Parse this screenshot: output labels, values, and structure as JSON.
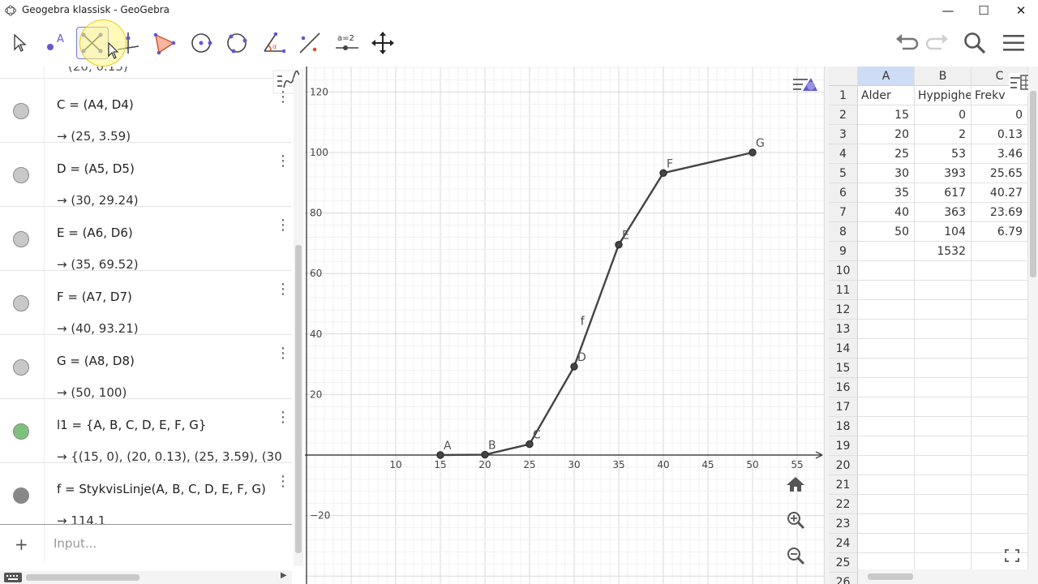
{
  "window": {
    "title": "Geogebra klassisk - GeoGebra",
    "minimize": "—",
    "maximize": "☐",
    "close": "✕"
  },
  "toolbar": {
    "tools": [
      "move-tool",
      "point-tool",
      "polygon-tool",
      "line-tool",
      "perpendicular-tool",
      "circle-tool",
      "conic-tool",
      "angle-tool",
      "reflect-tool",
      "slider-tool",
      "move-graphics-tool"
    ],
    "slider_label": "a=2",
    "right_icons": [
      "undo-icon",
      "redo-icon",
      "search-icon",
      "menu-icon"
    ]
  },
  "algebra": {
    "rows": [
      {
        "def": "C = (A4, D4)",
        "val": "→  (25, 3.59)",
        "color": "#c8c8c8"
      },
      {
        "def": "D = (A5, D5)",
        "val": "→  (30, 29.24)",
        "color": "#c8c8c8"
      },
      {
        "def": "E = (A6, D6)",
        "val": "→  (35, 69.52)",
        "color": "#c8c8c8"
      },
      {
        "def": "F = (A7, D7)",
        "val": "→  (40, 93.21)",
        "color": "#c8c8c8"
      },
      {
        "def": "G = (A8, D8)",
        "val": "→  (50, 100)",
        "color": "#c8c8c8"
      },
      {
        "def": "l1 = {A, B, C, D, E, F, G}",
        "val": "→  {(15, 0), (20, 0.13), (25, 3.59), (30",
        "color": "#7dbf7d"
      },
      {
        "def": "f = StykvisLinje(A, B, C, D, E, F, G)",
        "val": "→  114.1",
        "color": "#888888"
      }
    ],
    "input_placeholder": "Input...",
    "plus": "+"
  },
  "graphics": {
    "x_ticks": [
      "10",
      "15",
      "20",
      "25",
      "30",
      "35",
      "40",
      "45",
      "50",
      "55",
      "60"
    ],
    "y_ticks": [
      "120",
      "100",
      "80",
      "60",
      "40",
      "20",
      "−20"
    ],
    "points": [
      {
        "label": "A",
        "x": 15,
        "y": 0
      },
      {
        "label": "B",
        "x": 20,
        "y": 0.13
      },
      {
        "label": "C",
        "x": 25,
        "y": 3.59
      },
      {
        "label": "D",
        "x": 30,
        "y": 29.24
      },
      {
        "label": "E",
        "x": 35,
        "y": 69.52
      },
      {
        "label": "F",
        "x": 40,
        "y": 93.21
      },
      {
        "label": "G",
        "x": 50,
        "y": 100
      }
    ],
    "line_label": "f",
    "buttons": [
      "home-icon",
      "zoom-in-icon",
      "zoom-out-icon"
    ]
  },
  "spreadsheet": {
    "columns": [
      "A",
      "B",
      "C"
    ],
    "rows": [
      [
        "Alder",
        "Hyppighe",
        "Frekv"
      ],
      [
        "15",
        "0",
        "0"
      ],
      [
        "20",
        "2",
        "0.13"
      ],
      [
        "25",
        "53",
        "3.46"
      ],
      [
        "30",
        "393",
        "25.65"
      ],
      [
        "35",
        "617",
        "40.27"
      ],
      [
        "40",
        "363",
        "23.69"
      ],
      [
        "50",
        "104",
        "6.79"
      ],
      [
        "",
        "1532",
        ""
      ],
      [
        "",
        "",
        ""
      ],
      [
        "",
        "",
        ""
      ],
      [
        "",
        "",
        ""
      ],
      [
        "",
        "",
        ""
      ],
      [
        "",
        "",
        ""
      ],
      [
        "",
        "",
        ""
      ],
      [
        "",
        "",
        ""
      ],
      [
        "",
        "",
        ""
      ],
      [
        "",
        "",
        ""
      ],
      [
        "",
        "",
        ""
      ],
      [
        "",
        "",
        ""
      ],
      [
        "",
        "",
        ""
      ],
      [
        "",
        "",
        ""
      ],
      [
        "",
        "",
        ""
      ],
      [
        "",
        "",
        ""
      ],
      [
        "",
        "",
        ""
      ],
      [
        "",
        "",
        ""
      ]
    ]
  },
  "colors": {
    "accent": "#6557d2",
    "line": "#444444",
    "grid": "#e3e3e3",
    "selected_column": "#cfdcf5"
  }
}
